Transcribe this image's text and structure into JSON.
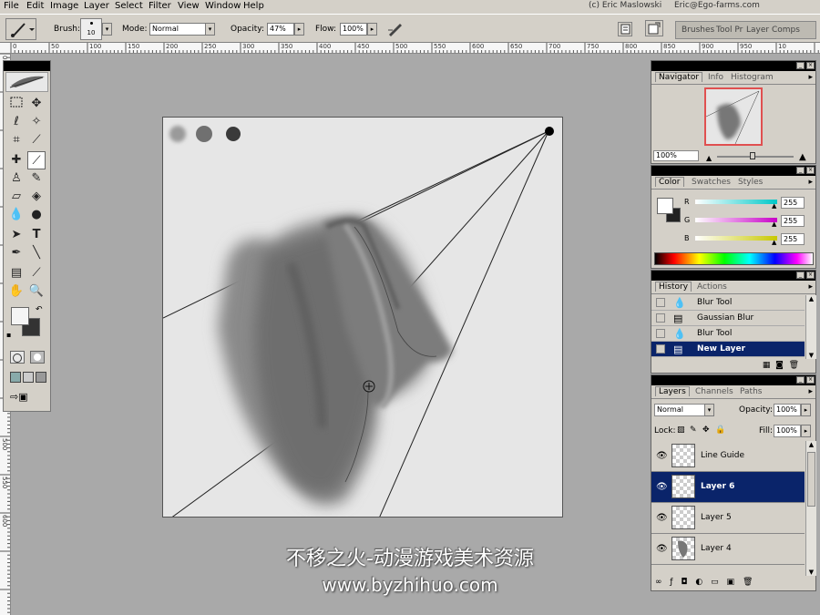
{
  "menu": {
    "items": [
      "File",
      "Edit",
      "Image",
      "Layer",
      "Select",
      "Filter",
      "View",
      "Window",
      "Help"
    ],
    "credit_name": "(c) Eric Maslowski",
    "credit_email": "Eric@Ego-farms.com"
  },
  "options": {
    "brush_label": "Brush:",
    "brush_size": "10",
    "mode_label": "Mode:",
    "mode_value": "Normal",
    "opacity_label": "Opacity:",
    "opacity_value": "47%",
    "flow_label": "Flow:",
    "flow_value": "100%",
    "well_tabs": [
      "Brushes",
      "Tool Pr",
      "Layer Comps"
    ]
  },
  "ruler": {
    "h_ticks": [
      "0",
      "50",
      "100",
      "150",
      "200",
      "250",
      "300",
      "350",
      "400",
      "450",
      "500",
      "550",
      "600",
      "650",
      "700",
      "750",
      "800",
      "850",
      "900",
      "950",
      "10"
    ],
    "v_ticks": [
      "0",
      "50",
      "100",
      "150",
      "200",
      "250",
      "300",
      "350",
      "400",
      "450",
      "500",
      "550",
      "600"
    ]
  },
  "navigator": {
    "tabs": [
      "Navigator",
      "Info",
      "Histogram"
    ],
    "zoom": "100%"
  },
  "color": {
    "tabs": [
      "Color",
      "Swatches",
      "Styles"
    ],
    "channels": [
      {
        "label": "R",
        "value": "255",
        "color": "#00c8c8"
      },
      {
        "label": "G",
        "value": "255",
        "color": "#c800c8"
      },
      {
        "label": "B",
        "value": "255",
        "color": "#c8c800"
      }
    ]
  },
  "history": {
    "tabs": [
      "History",
      "Actions"
    ],
    "items": [
      {
        "label": "Blur Tool",
        "icon": "drop-icon"
      },
      {
        "label": "Gaussian Blur",
        "icon": "filter-icon"
      },
      {
        "label": "Blur Tool",
        "icon": "drop-icon"
      },
      {
        "label": "New Layer",
        "icon": "layer-icon"
      }
    ]
  },
  "layers": {
    "tabs": [
      "Layers",
      "Channels",
      "Paths"
    ],
    "blend_mode": "Normal",
    "opacity_label": "Opacity:",
    "opacity_value": "100%",
    "lock_label": "Lock:",
    "fill_label": "Fill:",
    "fill_value": "100%",
    "items": [
      {
        "label": "Line Guide"
      },
      {
        "label": "Layer 6"
      },
      {
        "label": "Layer 5"
      },
      {
        "label": "Layer 4"
      }
    ]
  },
  "watermark": {
    "line1": "不移之火-动漫游戏美术资源",
    "line2": "www.byzhihuo.com"
  },
  "colors": {
    "ui_gray": "#d4d0c8",
    "selection": "#0a246a",
    "workspace": "#a9a9a9",
    "history_state": "#e05050"
  }
}
